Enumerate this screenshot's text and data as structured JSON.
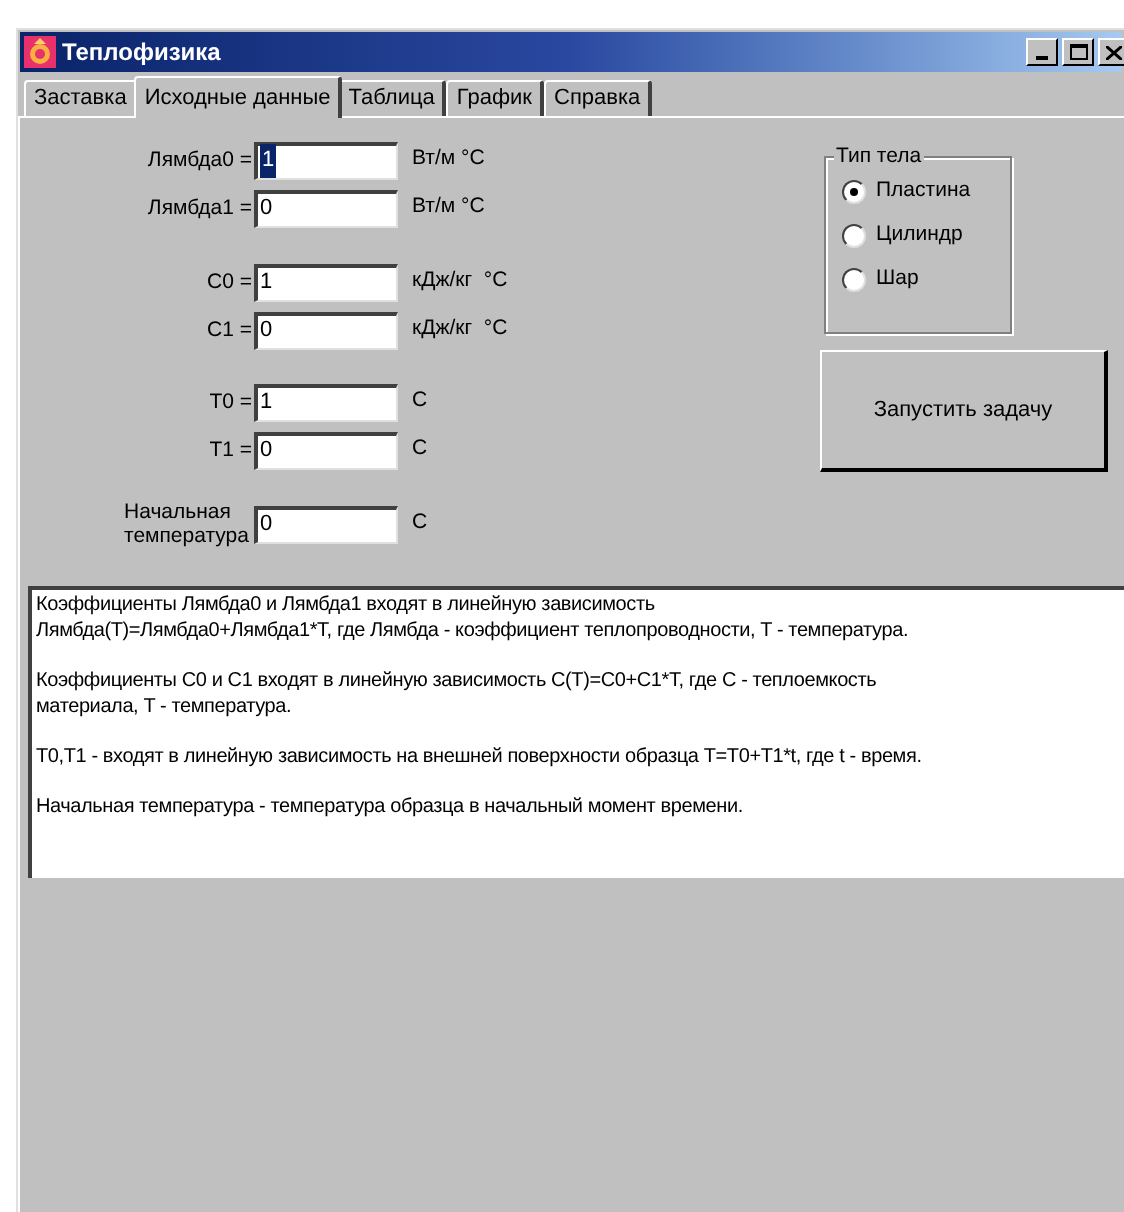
{
  "window": {
    "title": "Теплофизика"
  },
  "tabs": [
    {
      "label": "Заставка",
      "selected": false
    },
    {
      "label": "Исходные данные",
      "selected": true
    },
    {
      "label": "Таблица",
      "selected": false
    },
    {
      "label": "График",
      "selected": false
    },
    {
      "label": "Справка",
      "selected": false
    }
  ],
  "params": [
    {
      "label": "Лямбда0 =",
      "value": "1",
      "unit": "Вт/м °С",
      "selected": true
    },
    {
      "label": "Лямбда1 =",
      "value": "0",
      "unit": "Вт/м °С",
      "selected": false
    },
    {
      "label": "C0 =",
      "value": "1",
      "unit": "кДж/кг  °С",
      "selected": false
    },
    {
      "label": "C1 =",
      "value": "0",
      "unit": "кДж/кг  °С",
      "selected": false
    },
    {
      "label": "T0 =",
      "value": "1",
      "unit": "С",
      "selected": false
    },
    {
      "label": "T1 =",
      "value": "0",
      "unit": "С",
      "selected": false
    },
    {
      "label": "Начальная температура",
      "value": "0",
      "unit": "С",
      "selected": false
    }
  ],
  "body_type": {
    "title": "Тип тела",
    "options": [
      {
        "label": "Пластина",
        "selected": true
      },
      {
        "label": "Цилиндр",
        "selected": false
      },
      {
        "label": "Шар",
        "selected": false
      }
    ]
  },
  "run_button": "Запустить задачу",
  "help_text": [
    [
      "Коэффициенты Лямбда0 и Лямбда1 входят в линейную зависимость",
      "Лямбда(T)=Лямбда0+Лямбда1*T, где Лямбда - коэффициент теплопроводности, T - температура."
    ],
    [
      "Коэффициенты C0 и C1 входят в линейную зависимость C(T)=C0+C1*T, где C - теплоемкость",
      "материала, T - температура."
    ],
    [
      "T0,T1 - входят в линейную зависимость на внешней поверхности образца T=T0+T1*t, где t - время."
    ],
    [
      "Начальная температура - температура образца в начальный момент времени."
    ]
  ]
}
